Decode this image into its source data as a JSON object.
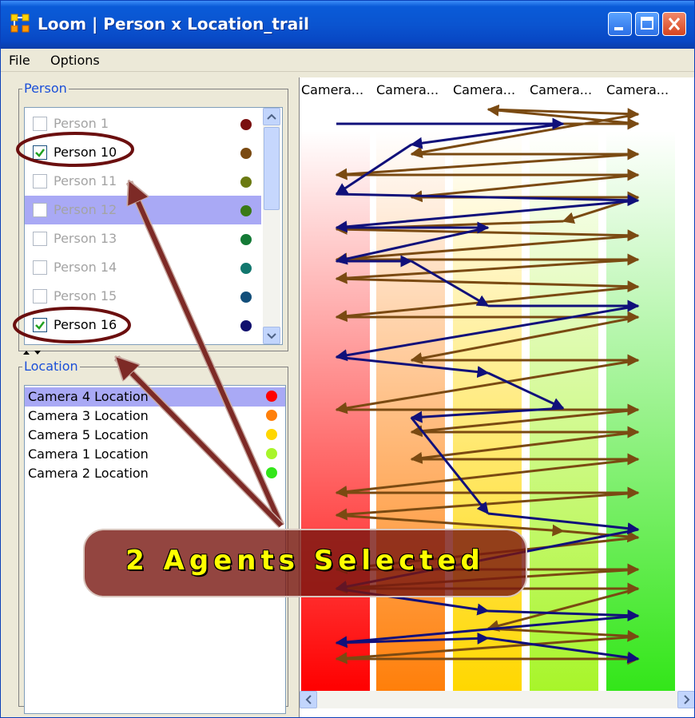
{
  "window": {
    "title": "Loom | Person x Location_trail"
  },
  "menu": [
    "File",
    "Options"
  ],
  "person_group": {
    "legend": "Person",
    "items": [
      {
        "label": "Person 1",
        "checked": false,
        "enabled": false,
        "highlighted": false,
        "color": "#7a1010"
      },
      {
        "label": "Person 10",
        "checked": true,
        "enabled": true,
        "highlighted": false,
        "color": "#7a4a12"
      },
      {
        "label": "Person 11",
        "checked": false,
        "enabled": false,
        "highlighted": false,
        "color": "#6b7a12"
      },
      {
        "label": "Person 12",
        "checked": false,
        "enabled": false,
        "highlighted": true,
        "color": "#3a7a16"
      },
      {
        "label": "Person 13",
        "checked": false,
        "enabled": false,
        "highlighted": false,
        "color": "#147a36"
      },
      {
        "label": "Person 14",
        "checked": false,
        "enabled": false,
        "highlighted": false,
        "color": "#12776e"
      },
      {
        "label": "Person 15",
        "checked": false,
        "enabled": false,
        "highlighted": false,
        "color": "#124e7a"
      },
      {
        "label": "Person 16",
        "checked": true,
        "enabled": true,
        "highlighted": false,
        "color": "#10106e"
      }
    ]
  },
  "location_group": {
    "legend": "Location",
    "items": [
      {
        "label": "Camera 4 Location",
        "selected": true,
        "color": "#ff0000"
      },
      {
        "label": "Camera 3 Location",
        "selected": false,
        "color": "#ff7f0a"
      },
      {
        "label": "Camera 5 Location",
        "selected": false,
        "color": "#ffd700"
      },
      {
        "label": "Camera 1 Location",
        "selected": false,
        "color": "#a8f52a"
      },
      {
        "label": "Camera 2 Location",
        "selected": false,
        "color": "#33e619"
      }
    ]
  },
  "trail": {
    "columns": [
      "Camera...",
      "Camera...",
      "Camera...",
      "Camera...",
      "Camera..."
    ],
    "column_colors": [
      "#ff0000",
      "#ff7f0a",
      "#ffd700",
      "#a8f52a",
      "#33e619"
    ],
    "trail_colors": {
      "person_10": "#7a4a12",
      "person_16": "#10107a"
    }
  },
  "annotation": {
    "text": "2 Agents Selected"
  }
}
